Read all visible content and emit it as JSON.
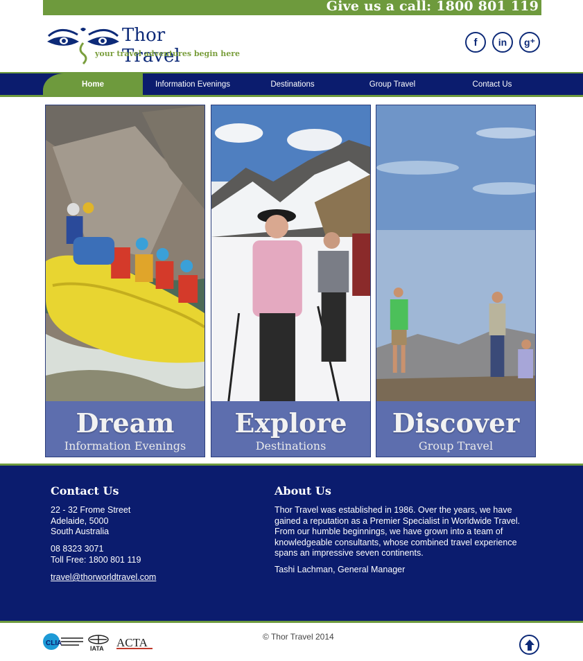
{
  "callbar": {
    "text": "Give us a call: 1800 801 119"
  },
  "brand": {
    "name": "Thor Travel",
    "tagline": "your travel adventures begin here"
  },
  "social": [
    {
      "name": "facebook-icon",
      "glyph": "f"
    },
    {
      "name": "linkedin-icon",
      "glyph": "in"
    },
    {
      "name": "google-plus-icon",
      "glyph": "g⁺"
    }
  ],
  "nav": {
    "items": [
      {
        "label": "Home",
        "active": true
      },
      {
        "label": "Information Evenings",
        "active": false
      },
      {
        "label": "Destinations",
        "active": false
      },
      {
        "label": "Group Travel",
        "active": false
      },
      {
        "label": "Contact Us",
        "active": false
      }
    ]
  },
  "panels": [
    {
      "title": "Dream",
      "subtitle": "Information Evenings"
    },
    {
      "title": "Explore",
      "subtitle": "Destinations"
    },
    {
      "title": "Discover",
      "subtitle": "Group Travel"
    }
  ],
  "footer": {
    "contact": {
      "heading": "Contact Us",
      "address1": "22 - 32 Frome Street",
      "address2": "Adelaide, 5000",
      "address3": "South Australia",
      "phone": "08 8323 3071",
      "tollfree": "Toll Free: 1800 801 119",
      "email": "travel@thorworldtravel.com"
    },
    "about": {
      "heading": "About Us",
      "body": "Thor Travel was established in 1986. Over the years, we have gained a reputation as a Premier Specialist in Worldwide Travel. From our humble beginnings, we have grown into a team of knowledgeable consultants, whose combined travel experience spans an impressive seven continents.",
      "signature": "Tashi Lachman, General Manager"
    },
    "copyright": "© Thor Travel 2014",
    "badges": {
      "clia": "CLIA",
      "iata": "IATA",
      "acta": "ACTA"
    }
  },
  "colors": {
    "navy": "#0b1c6e",
    "green": "#6e9a3d",
    "panel_overlay": "#394e9c"
  }
}
